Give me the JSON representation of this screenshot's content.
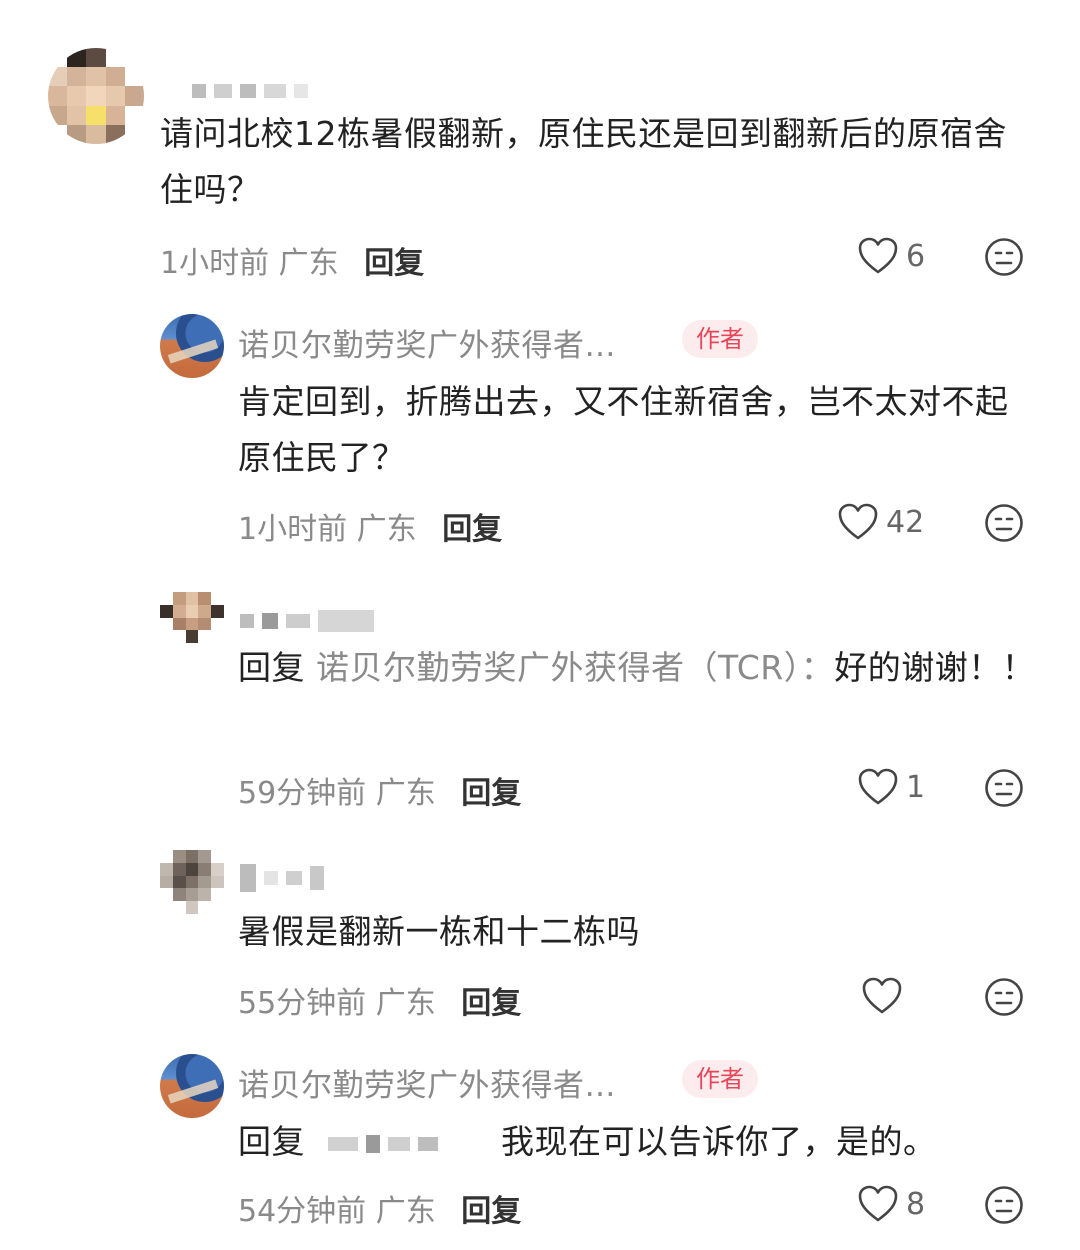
{
  "comments": [
    {
      "text": "请问北校12栋暑假翻新，原住民还是回到翻新后的原宿舍住吗？",
      "time": "1小时前",
      "location": "广东",
      "reply_label": "回复",
      "likes": "6"
    },
    {
      "username": "诺贝尔勤劳奖广外获得者…",
      "author_tag": "作者",
      "text": "肯定回到，折腾出去，又不住新宿舍，岂不太对不起原住民了？",
      "time": "1小时前",
      "location": "广东",
      "reply_label": "回复",
      "likes": "42"
    },
    {
      "reply_prefix": "回复",
      "reply_target": "诺贝尔勤劳奖广外获得者（TCR）：",
      "text": "好的谢谢！！",
      "time": "59分钟前",
      "location": "广东",
      "reply_label": "回复",
      "likes": "1"
    },
    {
      "text": "暑假是翻新一栋和十二栋吗",
      "time": "55分钟前",
      "location": "广东",
      "reply_label": "回复",
      "likes": ""
    },
    {
      "username": "诺贝尔勤劳奖广外获得者…",
      "author_tag": "作者",
      "reply_prefix": "回复",
      "text": "我现在可以告诉你了，是的。",
      "time": "54分钟前",
      "location": "广东",
      "reply_label": "回复",
      "likes": "8"
    }
  ],
  "icons": {
    "like": "heart-outline-icon",
    "reaction": "neutral-face-icon"
  },
  "colors": {
    "author_tag": "#e8475a",
    "author_tag_bg": "#fdecee",
    "secondary_text": "#8a8a8a"
  }
}
